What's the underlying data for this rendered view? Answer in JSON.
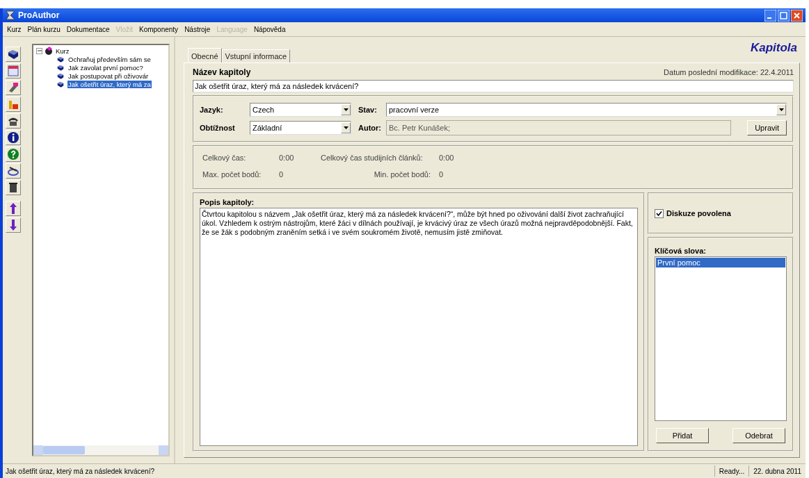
{
  "window": {
    "title": "ProAuthor"
  },
  "menu": [
    {
      "label": "Kurz",
      "disabled": false
    },
    {
      "label": "Plán kurzu",
      "disabled": false
    },
    {
      "label": "Dokumentace",
      "disabled": false
    },
    {
      "label": "Vložit",
      "disabled": true
    },
    {
      "label": "Komponenty",
      "disabled": false
    },
    {
      "label": "Nástroje",
      "disabled": false
    },
    {
      "label": "Language",
      "disabled": true
    },
    {
      "label": "Nápověda",
      "disabled": false
    }
  ],
  "tree": {
    "label": "Kurz",
    "expanded": true,
    "children": [
      {
        "label": "Ochraňuj především sám se",
        "selected": false
      },
      {
        "label": "Jak zavolat první pomoc?",
        "selected": false
      },
      {
        "label": "Jak postupovat při oživovár",
        "selected": false
      },
      {
        "label": "Jak ošetřit úraz, který má za",
        "selected": true
      }
    ]
  },
  "header_title": "Kapitola",
  "tabs": [
    {
      "label": "Obecné",
      "selected": true
    },
    {
      "label": "Vstupní informace",
      "selected": false
    }
  ],
  "chapter": {
    "name_label": "Název kapitoly",
    "modified_label": "Datum poslední modifikace:",
    "modified_value": "22.4.2011",
    "name_value": "Jak ošetřit úraz, který má za následek krvácení?"
  },
  "language": {
    "label": "Jazyk:",
    "value": "Czech"
  },
  "state": {
    "label": "Stav:",
    "value": "pracovní verze"
  },
  "difficulty": {
    "label": "Obtížnost",
    "value": "Základní"
  },
  "author": {
    "label": "Autor:",
    "value": "Bc. Petr Kunášek;",
    "disabled": true
  },
  "edit_button": "Upravit",
  "stats": [
    {
      "label": "Celkový čas:",
      "value": "0:00"
    },
    {
      "label": "Celkový čas studijních článků:",
      "value": "0:00"
    },
    {
      "label": "Max. počet bodů:",
      "value": "0"
    },
    {
      "label": "Min. počet bodů:",
      "value": "0"
    }
  ],
  "description": {
    "label": "Popis kapitoly:",
    "value": "Čtvrtou kapitolou s názvem „Jak ošetřit úraz, který má za následek krvácení?“, může být hned po oživování další život zachraňující úkol. Vzhledem k ostrým nástrojům, které žáci v dílnách používají, je krvácivý úraz ze všech úrazů možná nejpravděpodobnější. Fakt, že se žák s podobným zraněním setká i ve svém soukromém životě, nemusím jistě zmiňovat."
  },
  "discussion": {
    "label": "Diskuze povolena",
    "checked": true
  },
  "keywords": {
    "label": "Klíčová slova:",
    "items": [
      {
        "label": "První pomoc",
        "selected": true
      }
    ]
  },
  "keyword_buttons": [
    "Přidat",
    "Odebrat"
  ],
  "status_bar": {
    "message": "Jak ošetřit úraz, který má za následek krvácení?",
    "state": "Ready...",
    "date": "22. dubna 2011"
  }
}
